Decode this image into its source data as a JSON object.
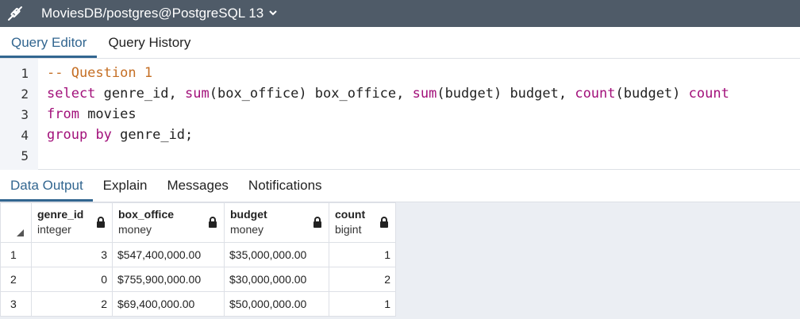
{
  "titlebar": {
    "title": "MoviesDB/postgres@PostgreSQL 13",
    "chevron": "⌄",
    "icon": "connection-icon"
  },
  "editor_tabs": [
    "Query Editor",
    "Query History"
  ],
  "editor": {
    "line_numbers": [
      "1",
      "2",
      "3",
      "4",
      "5"
    ],
    "line1": {
      "comment": "-- Question 1"
    },
    "line2": {
      "kw_select": "select",
      "t1": " genre_id, ",
      "kw_sum1": "sum",
      "t2": "(box_office) box_office, ",
      "kw_sum2": "sum",
      "t3": "(budget) budget, ",
      "kw_count1": "count",
      "t4": "(budget) ",
      "kw_count2": "count"
    },
    "line3": {
      "kw_from": "from",
      "t1": " movies"
    },
    "line4": {
      "kw_group": "group",
      "t1": " ",
      "kw_by": "by",
      "t2": " genre_id;"
    }
  },
  "output_tabs": [
    "Data Output",
    "Explain",
    "Messages",
    "Notifications"
  ],
  "grid": {
    "columns": [
      {
        "name": "genre_id",
        "type": "integer"
      },
      {
        "name": "box_office",
        "type": "money"
      },
      {
        "name": "budget",
        "type": "money"
      },
      {
        "name": "count",
        "type": "bigint"
      }
    ],
    "rows": [
      {
        "n": "1",
        "genre_id": "3",
        "box_office": "$547,400,000.00",
        "budget": "$35,000,000.00",
        "count": "1"
      },
      {
        "n": "2",
        "genre_id": "0",
        "box_office": "$755,900,000.00",
        "budget": "$30,000,000.00",
        "count": "2"
      },
      {
        "n": "3",
        "genre_id": "2",
        "box_office": "$69,400,000.00",
        "budget": "$50,000,000.00",
        "count": "1"
      }
    ]
  },
  "colors": {
    "titlebar_bg": "#4f5b68",
    "active_tab": "#326690",
    "keyword": "#a2107a",
    "comment": "#c56f25"
  }
}
